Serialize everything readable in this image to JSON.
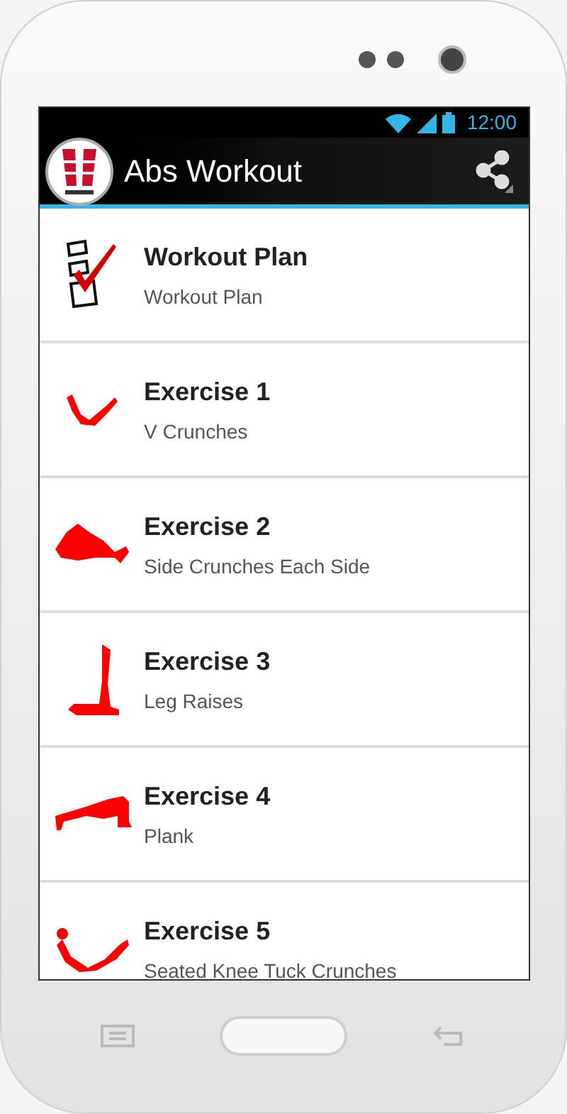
{
  "status_bar": {
    "time": "12:00"
  },
  "action_bar": {
    "title": "Abs Workout"
  },
  "items": [
    {
      "kind": "checklist",
      "title": "Workout Plan",
      "subtitle": "Workout Plan"
    },
    {
      "kind": "v-crunch",
      "title": "Exercise 1",
      "subtitle": "V Crunches"
    },
    {
      "kind": "side-crunch",
      "title": "Exercise 2",
      "subtitle": "Side Crunches Each Side"
    },
    {
      "kind": "leg-raise",
      "title": "Exercise 3",
      "subtitle": "Leg Raises"
    },
    {
      "kind": "plank",
      "title": "Exercise 4",
      "subtitle": "Plank"
    },
    {
      "kind": "knee-tuck",
      "title": "Exercise 5",
      "subtitle": "Seated Knee Tuck Crunches"
    }
  ]
}
